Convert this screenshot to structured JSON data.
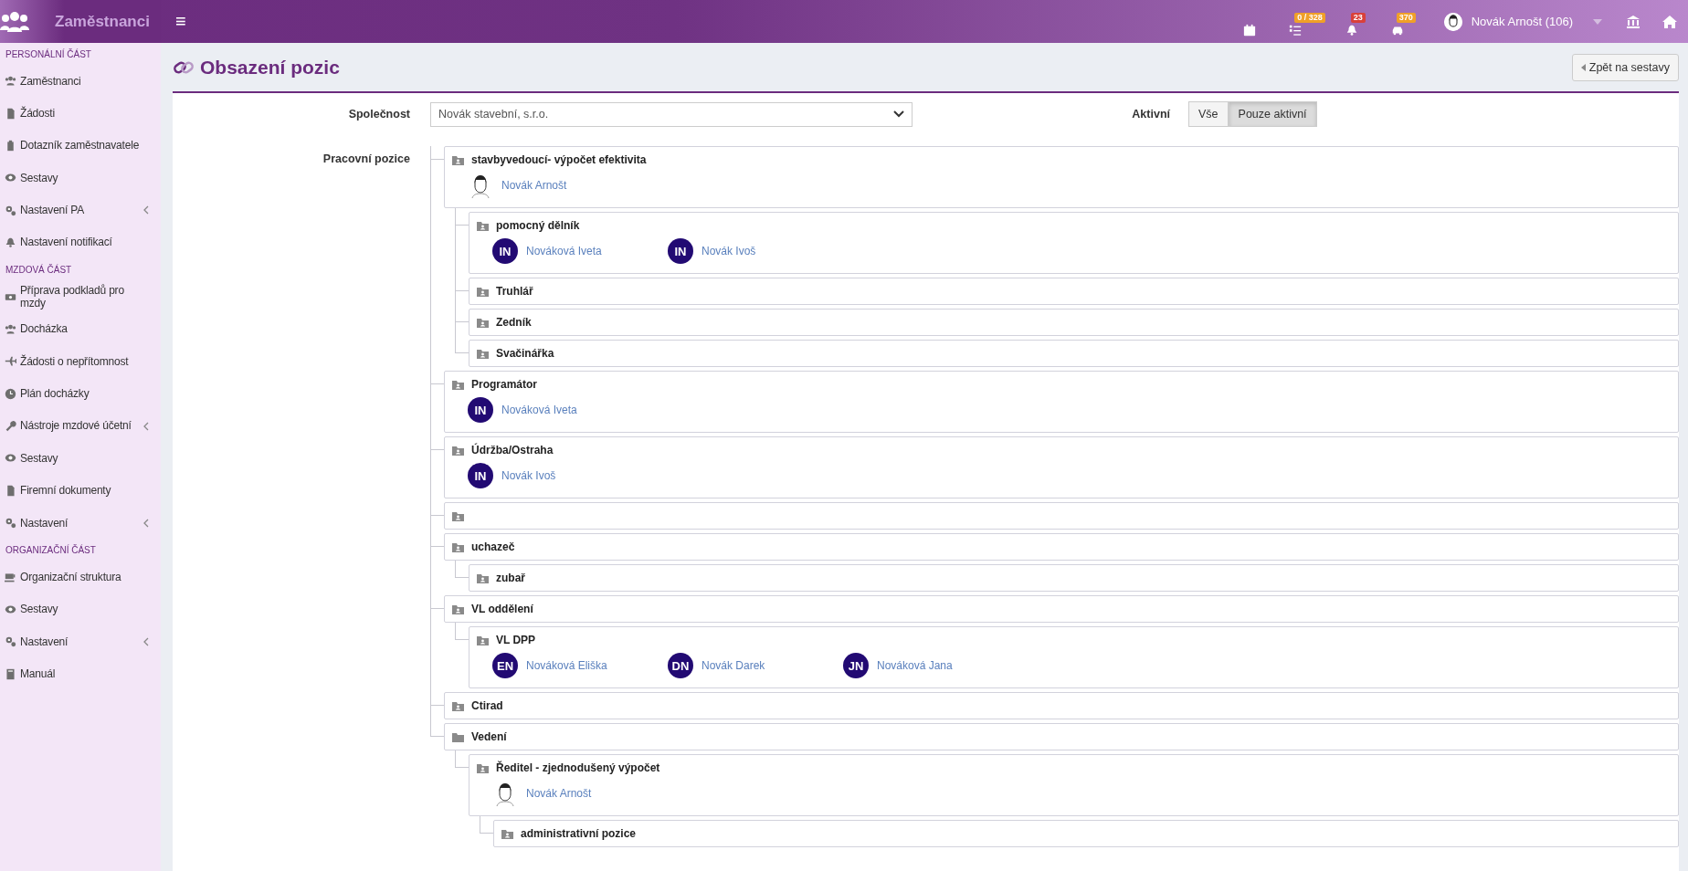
{
  "topbar": {
    "app_name": "Zaměstnanci",
    "menu_glyph": "≡",
    "indicators": [
      {
        "kind": "calendar"
      },
      {
        "kind": "tasks",
        "badge": "0 / 328",
        "color": "#f0a028"
      },
      {
        "kind": "bell",
        "badge": "23",
        "color": "#d9413a"
      },
      {
        "kind": "car",
        "badge": "370",
        "color": "#f0a028"
      }
    ],
    "user": "Novák Arnošt (106)"
  },
  "sidebar": {
    "sections": [
      {
        "title": "PERSONÁLNÍ ČÁST",
        "items": [
          {
            "label": "Zaměstnanci",
            "kind": "people",
            "submenu": false
          },
          {
            "label": "Žádosti",
            "kind": "file",
            "submenu": false
          },
          {
            "label": "Dotazník zaměstnavatele",
            "kind": "clipboard",
            "submenu": false
          },
          {
            "label": "Sestavy",
            "kind": "eye",
            "submenu": false
          },
          {
            "label": "Nastavení PA",
            "kind": "gears",
            "submenu": true
          },
          {
            "label": "Nastavení notifikací",
            "kind": "bell",
            "submenu": false
          }
        ]
      },
      {
        "title": "MZDOVÁ ČÁST",
        "items": [
          {
            "label": "Příprava podkladů pro mzdy",
            "kind": "money",
            "submenu": false
          },
          {
            "label": "Docházka",
            "kind": "people",
            "submenu": false
          },
          {
            "label": "Žádosti o nepřítomnost",
            "kind": "plane",
            "submenu": false
          },
          {
            "label": "Plán docházky",
            "kind": "clock",
            "submenu": false
          },
          {
            "label": "Nástroje mzdové účetní",
            "kind": "wrench",
            "submenu": true
          },
          {
            "label": "Sestavy",
            "kind": "eye",
            "submenu": false
          },
          {
            "label": "Firemní dokumenty",
            "kind": "file",
            "submenu": false
          },
          {
            "label": "Nastavení",
            "kind": "gears",
            "submenu": true
          }
        ]
      },
      {
        "title": "ORGANIZAČNÍ ČÁST",
        "items": [
          {
            "label": "Organizační struktura",
            "kind": "cup",
            "submenu": false
          },
          {
            "label": "Sestavy",
            "kind": "eye",
            "submenu": false
          },
          {
            "label": "Nastavení",
            "kind": "gears",
            "submenu": true
          },
          {
            "label": "Manuál",
            "kind": "book",
            "submenu": false
          }
        ]
      }
    ]
  },
  "page": {
    "title": "Obsazení pozic",
    "back_button": "Zpět na sestavy"
  },
  "filters": {
    "company_label": "Společnost",
    "company": "Novák stavební, s.r.o.",
    "active_label": "Aktivní",
    "active_options": [
      {
        "label": "Vše",
        "selected": false
      },
      {
        "label": "Pouze aktivní",
        "selected": true
      }
    ]
  },
  "positions_label": "Pracovní pozice",
  "tree": [
    {
      "kind": "position",
      "title": "stavbyvedoucí- výpočet efektivita",
      "members": [
        {
          "kind": "photo",
          "name": "Novák Arnošt"
        }
      ],
      "children": [
        {
          "kind": "position",
          "title": "pomocný dělník",
          "members": [
            {
              "kind": "initials",
              "initials": "IN",
              "name": "Nováková Iveta"
            },
            {
              "kind": "initials",
              "initials": "IN",
              "name": "Novák Ivoš"
            }
          ]
        },
        {
          "kind": "position",
          "title": "Truhlář"
        },
        {
          "kind": "position",
          "title": "Zedník"
        },
        {
          "kind": "position",
          "title": "Svačinářka"
        }
      ]
    },
    {
      "kind": "position",
      "title": "Programátor",
      "members": [
        {
          "kind": "initials",
          "initials": "IN",
          "name": "Nováková Iveta"
        }
      ]
    },
    {
      "kind": "position",
      "title": "Údržba/Ostraha",
      "members": [
        {
          "kind": "initials",
          "initials": "IN",
          "name": "Novák Ivoš"
        }
      ]
    },
    {
      "kind": "position"
    },
    {
      "kind": "position",
      "title": "uchazeč",
      "children": [
        {
          "kind": "position",
          "title": "zubař"
        }
      ]
    },
    {
      "kind": "position",
      "title": "VL oddělení",
      "children": [
        {
          "kind": "position",
          "title": "VL DPP",
          "members": [
            {
              "kind": "initials",
              "initials": "EN",
              "name": "Nováková Eliška"
            },
            {
              "kind": "initials",
              "initials": "DN",
              "name": "Novák Darek"
            },
            {
              "kind": "initials",
              "initials": "JN",
              "name": "Nováková Jana"
            }
          ]
        }
      ]
    },
    {
      "kind": "position",
      "title": "Ctirad"
    },
    {
      "kind": "folder",
      "title": "Vedení",
      "children": [
        {
          "kind": "position",
          "title": "Ředitel - zjednodušený výpočet",
          "members": [
            {
              "kind": "photo",
              "name": "Novák Arnošt"
            }
          ],
          "children": [
            {
              "kind": "position",
              "title": "administrativní pozice"
            }
          ]
        }
      ]
    }
  ]
}
